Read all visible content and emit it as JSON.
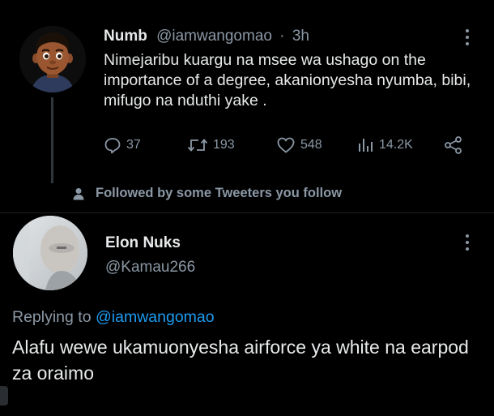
{
  "tweet": {
    "author_name": "Numb",
    "author_handle": "@iamwangomao",
    "separator": "·",
    "time": "3h",
    "text": "Nimejaribu kuargu na msee wa ushago on the importance of a degree, akanionyesha nyumba, bibi, mifugo na nduthi yake .",
    "replies": "37",
    "retweets": "193",
    "likes": "548",
    "views": "14.2K",
    "icons": [
      "more-icon",
      "reply-icon",
      "retweet-icon",
      "like-icon",
      "views-icon",
      "share-icon"
    ]
  },
  "social_context": {
    "text": "Followed by some Tweeters you follow",
    "icon": "person-icon"
  },
  "reply": {
    "author_name": "Elon Nuks",
    "author_handle": "@Kamau266",
    "replying_prefix": "Replying to",
    "replying_to": "@iamwangomao",
    "text": "Alafu wewe ukamuonyesha airforce ya white na earpod za oraimo"
  },
  "colors": {
    "background": "#000000",
    "text_primary": "#e7e9ea",
    "text_secondary": "#8b98a5",
    "link": "#1d9bf0"
  }
}
